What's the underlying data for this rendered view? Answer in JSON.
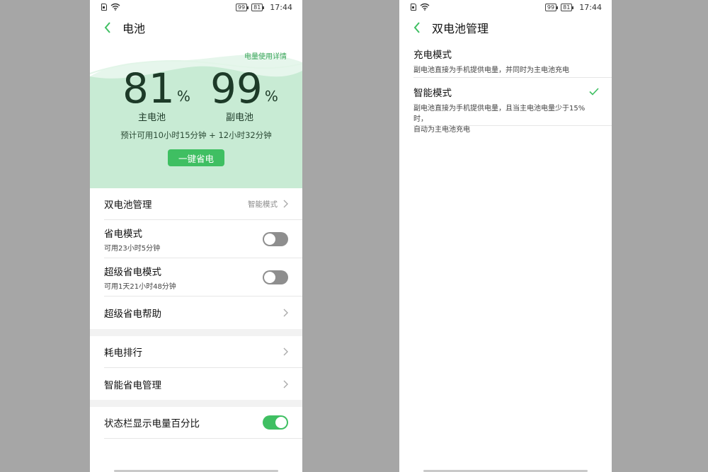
{
  "status_bar": {
    "battery_a": "99",
    "battery_b": "81",
    "time": "17:44"
  },
  "left_screen": {
    "title": "电池",
    "usage_link": "电量使用详情",
    "main_battery": {
      "percent": "81",
      "unit": "%",
      "label": "主电池"
    },
    "sub_battery": {
      "percent": "99",
      "unit": "%",
      "label": "副电池"
    },
    "estimate": "预计可用10小时15分钟 + 12小时32分钟",
    "one_key_save": "一键省电",
    "items": [
      {
        "label": "双电池管理",
        "value": "智能模式"
      },
      {
        "label": "省电模式",
        "sub": "可用23小时5分钟",
        "toggle": false
      },
      {
        "label": "超级省电模式",
        "sub": "可用1天21小时48分钟",
        "toggle": false
      },
      {
        "label": "超级省电帮助"
      },
      {
        "label": "耗电排行"
      },
      {
        "label": "智能省电管理"
      },
      {
        "label": "状态栏显示电量百分比",
        "toggle": true
      }
    ]
  },
  "right_screen": {
    "title": "双电池管理",
    "options": [
      {
        "title": "充电模式",
        "desc": "副电池直接为手机提供电量，并同时为主电池充电",
        "selected": false
      },
      {
        "title": "智能模式",
        "desc_line1": "副电池直接为手机提供电量，且当主电池电量少于15%时，",
        "desc_line2": "自动为主电池充电",
        "selected": true
      }
    ]
  },
  "colors": {
    "accent": "#3fbf62",
    "hero_bg": "#c8ebd4",
    "backdrop": "#a6a6a6"
  }
}
